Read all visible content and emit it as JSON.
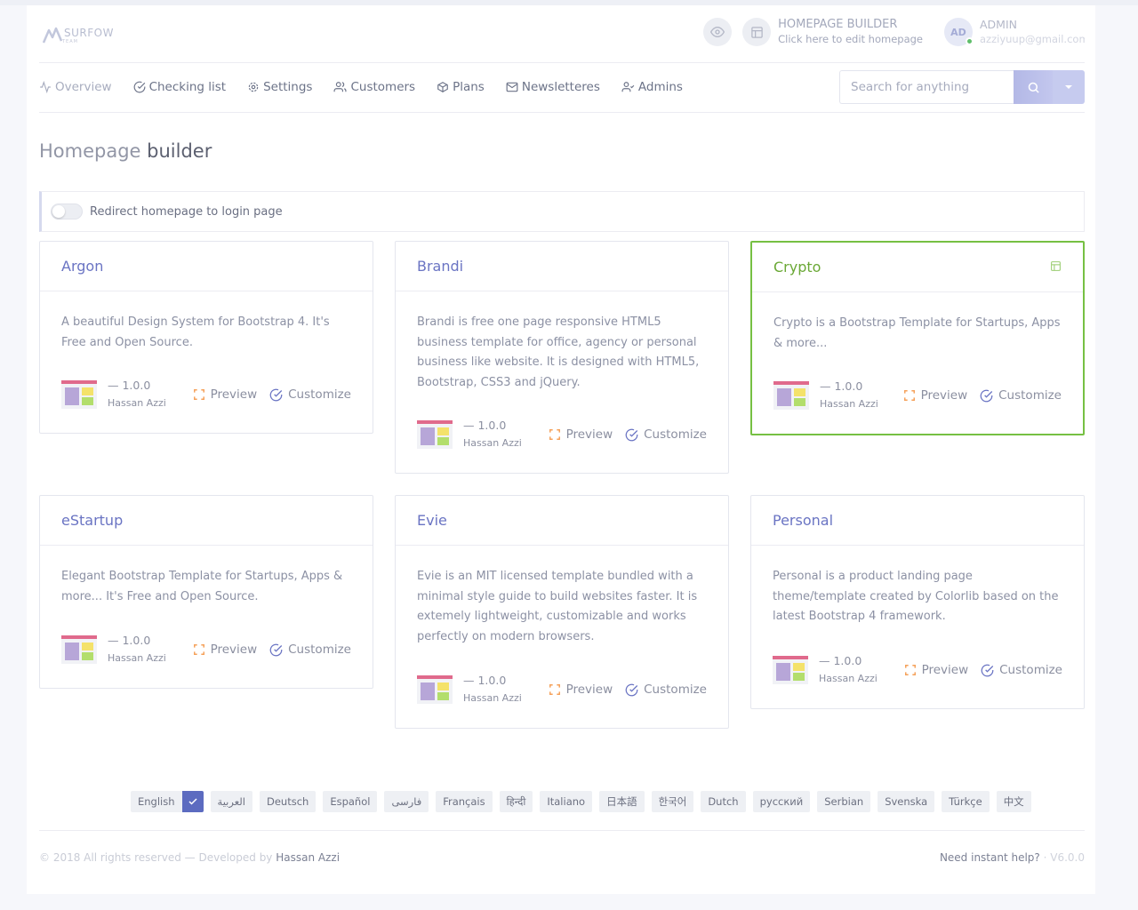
{
  "header": {
    "logo_text": "SURFOW",
    "logo_sub": "TEAM",
    "builder_title": "HOMEPAGE BUILDER",
    "builder_sub": "Click here to edit homepage",
    "avatar_initials": "AD",
    "admin_name": "ADMIN",
    "admin_email": "azziyuup@gmail.com"
  },
  "nav": {
    "items": [
      {
        "label": "Overview",
        "icon": "activity-icon"
      },
      {
        "label": "Checking list",
        "icon": "check-circle-icon"
      },
      {
        "label": "Settings",
        "icon": "gear-icon"
      },
      {
        "label": "Customers",
        "icon": "users-icon"
      },
      {
        "label": "Plans",
        "icon": "box-icon"
      },
      {
        "label": "Newsletteres",
        "icon": "mail-icon"
      },
      {
        "label": "Admins",
        "icon": "user-check-icon"
      }
    ],
    "search_placeholder": "Search for anything"
  },
  "page": {
    "title_first": "Homepage",
    "title_rest": " builder",
    "redirect_label": "Redirect homepage to login page"
  },
  "templates": [
    {
      "name": "Argon",
      "desc": "A beautiful Design System for Bootstrap 4. It's Free and Open Source.",
      "version": "— 1.0.0",
      "author": "Hassan Azzi",
      "preview": "Preview",
      "customize": "Customize"
    },
    {
      "name": "Brandi",
      "desc": "Brandi is free one page responsive HTML5 business template for office, agency or personal business like website. It is designed with HTML5, Bootstrap, CSS3 and jQuery.",
      "version": "— 1.0.0",
      "author": "Hassan Azzi",
      "preview": "Preview",
      "customize": "Customize"
    },
    {
      "name": "Crypto",
      "desc": "Crypto is a Bootstrap Template for Startups, Apps & more...",
      "version": "— 1.0.0",
      "author": "Hassan Azzi",
      "preview": "Preview",
      "customize": "Customize"
    },
    {
      "name": "eStartup",
      "desc": "Elegant Bootstrap Template for Startups, Apps & more... It's Free and Open Source.",
      "version": "— 1.0.0",
      "author": "Hassan Azzi",
      "preview": "Preview",
      "customize": "Customize"
    },
    {
      "name": "Evie",
      "desc": "Evie is an MIT licensed template bundled with a minimal style guide to build websites faster. It is extemely lightweight, customizable and works perfectly on modern browsers.",
      "version": "— 1.0.0",
      "author": "Hassan Azzi",
      "preview": "Preview",
      "customize": "Customize"
    },
    {
      "name": "Personal",
      "desc": "Personal is a product landing page theme/template created by Colorlib based on the latest Bootstrap 4 framework.",
      "version": "— 1.0.0",
      "author": "Hassan Azzi",
      "preview": "Preview",
      "customize": "Customize"
    }
  ],
  "languages": [
    "English",
    "العربية",
    "Deutsch",
    "Español",
    "فارسی",
    "Français",
    "हिन्दी",
    "Italiano",
    "日本語",
    "한국어",
    "Dutch",
    "русский",
    "Serbian",
    "Svenska",
    "Türkçe",
    "中文"
  ],
  "footer": {
    "copyright": "© 2018 All rights reserved — Developed by ",
    "author": "Hassan Azzi",
    "help": "Need instant help?",
    "sep": " · ",
    "version": "V6.0.0"
  },
  "colors": {
    "accent": "#5c6bc0",
    "active_border": "#76c043",
    "preview_icon": "#f5a15a"
  }
}
